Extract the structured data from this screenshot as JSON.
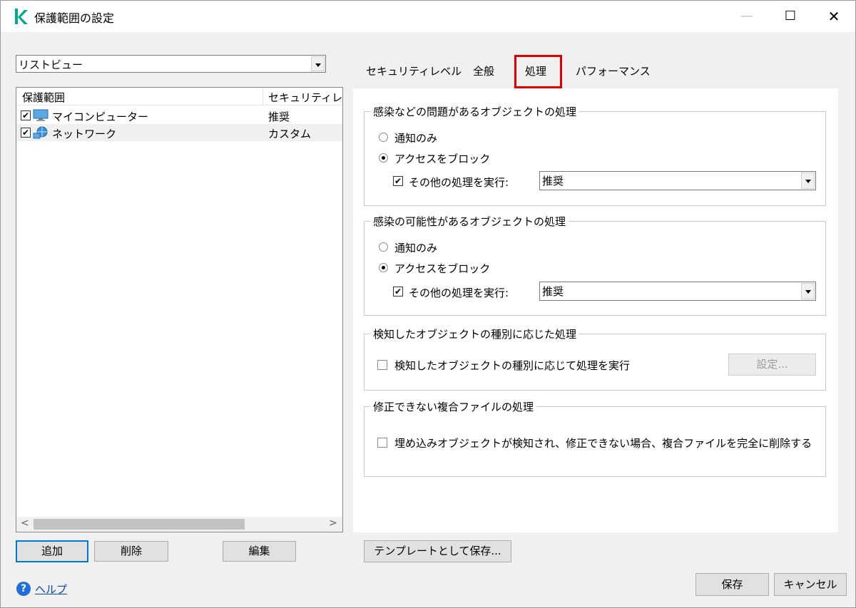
{
  "window": {
    "title": "保護範囲の設定",
    "minimize": "—",
    "maximize": "☐",
    "close": "✕"
  },
  "left": {
    "view_select": "リストビュー",
    "columns": [
      "保護範囲",
      "セキュリティレベル"
    ],
    "rows": [
      {
        "checked": true,
        "name": "マイコンピューター",
        "level": "推奨",
        "icon": "computer-icon"
      },
      {
        "checked": true,
        "name": "ネットワーク",
        "level": "カスタム",
        "icon": "network-icon"
      }
    ],
    "buttons": {
      "add": "追加",
      "delete": "削除",
      "edit": "編集"
    }
  },
  "tabs": [
    "セキュリティレベル",
    "全般",
    "処理",
    "パフォーマンス"
  ],
  "active_tab": "処理",
  "groups": {
    "infected": {
      "title": "感染などの問題があるオブジェクトの処理",
      "notify_only": "通知のみ",
      "block_access": "アクセスをブロック",
      "selected": "block_access",
      "other_action_checked": true,
      "other_action_label": "その他の処理を実行:",
      "other_action_value": "推奨"
    },
    "probably_infected": {
      "title": "感染の可能性があるオブジェクトの処理",
      "notify_only": "通知のみ",
      "block_access": "アクセスをブロック",
      "selected": "block_access",
      "other_action_checked": true,
      "other_action_label": "その他の処理を実行:",
      "other_action_value": "推奨"
    },
    "by_type": {
      "title": "検知したオブジェクトの種別に応じた処理",
      "checkbox_label": "検知したオブジェクトの種別に応じて処理を実行",
      "checked": false,
      "settings_button": "設定..."
    },
    "compound": {
      "title": "修正できない複合ファイルの処理",
      "checkbox_label": "埋め込みオブジェクトが検知され、修正できない場合、複合ファイルを完全に削除する",
      "checked": false
    }
  },
  "save_template_button": "テンプレートとして保存...",
  "help_link": "ヘルプ",
  "footer": {
    "save": "保存",
    "cancel": "キャンセル"
  },
  "colors": {
    "highlight": "#e00000",
    "accent": "#0078d7",
    "logo": "#00a88e"
  }
}
